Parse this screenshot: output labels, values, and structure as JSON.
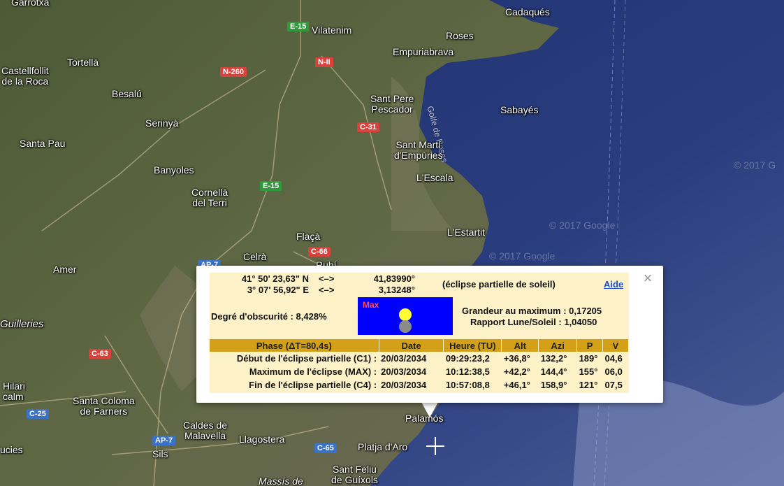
{
  "map": {
    "places": {
      "garrotxa": "Garrotxa",
      "cadaques": "Cadaqués",
      "vilatenim": "Vilatenim",
      "roses": "Roses",
      "tortella": "Tortellà",
      "empuriabrava": "Empuriabrava",
      "castellfollit": "Castellfollit\nde la Roca",
      "besalu": "Besalú",
      "santpere": "Sant Pere\nPescador",
      "golfe": "Golfe de Roses",
      "sabayes": "Sabayés",
      "serinya": "Serinyà",
      "santmarti": "Sant Martí\nd'Empúries",
      "santapau": "Santa Pau",
      "banyoles": "Banyoles",
      "lescala": "L'Escala",
      "cornella": "Cornellà\ndel Terri",
      "lestartit": "L'Estartit",
      "flaca": "Flaçà",
      "celra": "Celrà",
      "rubi": "Rubí",
      "amer": "Amer",
      "guilleries": "Guilleries",
      "hilari": "Hilari\ncalm",
      "santacoloma": "Santa Coloma\nde Farners",
      "caldes": "Caldes de\nMalavella",
      "llagostera": "Llagostera",
      "platja": "Platja d'Aro",
      "palamos": "Palamós",
      "santfeliu": "Sant Feliu\nde Guíxols",
      "massis": "Massís de",
      "sils": "Sils",
      "ucies": "ucies"
    },
    "roads": {
      "e15a": "E-15",
      "n260": "N-260",
      "n2": "N-II",
      "c31": "C-31",
      "e15b": "E-15",
      "c66": "C-66",
      "ap7a": "AP-7",
      "c63": "C-63",
      "c25": "C-25",
      "ap7b": "AP-7",
      "c65": "C-65"
    },
    "copyright1": "© 2017 Google",
    "copyright2": "© 2017 Google",
    "copyright3": "© 2017 G"
  },
  "popup": {
    "close_label": "×",
    "coords": {
      "lat_dms": "41° 50' 23,63\" N",
      "lon_dms": "3° 07' 56,92\" E",
      "arrow": "<–>",
      "lat_dec": "41,83990°",
      "lon_dec": "3,13248°"
    },
    "eclipse_type": "(éclipse partielle de soleil)",
    "help_link": "Aide",
    "obscuration": "Degré d'obscurité : 8,428%",
    "sky_label": "Max",
    "magnitude": "Grandeur au maximum : 0,17205",
    "ratio": "Rapport Lune/Soleil : 1,04050",
    "table": {
      "headers": [
        "Phase (ΔT=80,4s)",
        "Date",
        "Heure (TU)",
        "Alt",
        "Azi",
        "P",
        "V"
      ],
      "rows": [
        [
          "Début de l'éclipse partielle (C1) :",
          "20/03/2034",
          "09:29:23,2",
          "+36,8°",
          "132,2°",
          "189°",
          "04,6"
        ],
        [
          "Maximum de l'éclipse (MAX) :",
          "20/03/2034",
          "10:12:38,5",
          "+42,2°",
          "144,4°",
          "155°",
          "06,0"
        ],
        [
          "Fin de l'éclipse partielle (C4) :",
          "20/03/2034",
          "10:57:08,8",
          "+46,1°",
          "158,9°",
          "121°",
          "07,5"
        ]
      ]
    }
  }
}
